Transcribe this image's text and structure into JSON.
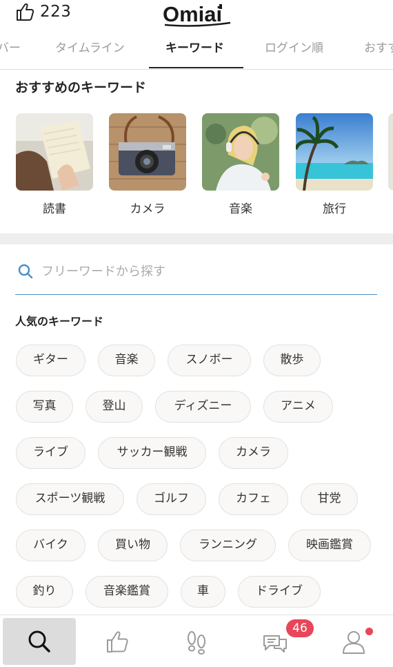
{
  "header": {
    "like_count": "223",
    "logo_text": "Omiai"
  },
  "tabs": [
    {
      "label": "バー"
    },
    {
      "label": "タイムライン"
    },
    {
      "label": "キーワード"
    },
    {
      "label": "ログイン順"
    },
    {
      "label": "おすす"
    }
  ],
  "recommended": {
    "title": "おすすめのキーワード",
    "items": [
      {
        "label": "読書"
      },
      {
        "label": "カメラ"
      },
      {
        "label": "音楽"
      },
      {
        "label": "旅行"
      }
    ]
  },
  "search": {
    "placeholder": "フリーワードから探す"
  },
  "popular": {
    "title": "人気のキーワード",
    "chips": [
      {
        "label": "ギター"
      },
      {
        "label": "音楽"
      },
      {
        "label": "スノボー"
      },
      {
        "label": "散歩"
      },
      {
        "label": "写真"
      },
      {
        "label": "登山"
      },
      {
        "label": "ディズニー"
      },
      {
        "label": "アニメ"
      },
      {
        "label": "ライブ"
      },
      {
        "label": "サッカー観戦"
      },
      {
        "label": "カメラ"
      },
      {
        "label": "スポーツ観戦"
      },
      {
        "label": "ゴルフ"
      },
      {
        "label": "カフェ"
      },
      {
        "label": "甘党"
      },
      {
        "label": "バイク"
      },
      {
        "label": "買い物"
      },
      {
        "label": "ランニング"
      },
      {
        "label": "映画鑑賞"
      },
      {
        "label": "釣り"
      },
      {
        "label": "音楽鑑賞"
      },
      {
        "label": "車"
      },
      {
        "label": "ドライブ"
      }
    ]
  },
  "bottom_nav": {
    "items": [
      {
        "icon": "search-icon"
      },
      {
        "icon": "thumbs-up-icon"
      },
      {
        "icon": "footprints-icon"
      },
      {
        "icon": "messages-icon"
      },
      {
        "icon": "profile-icon"
      }
    ],
    "message_badge": "46"
  },
  "colors": {
    "badge": "#e8465a",
    "search_underline": "#4a90c8",
    "chip_bg": "#f9f8f6"
  }
}
